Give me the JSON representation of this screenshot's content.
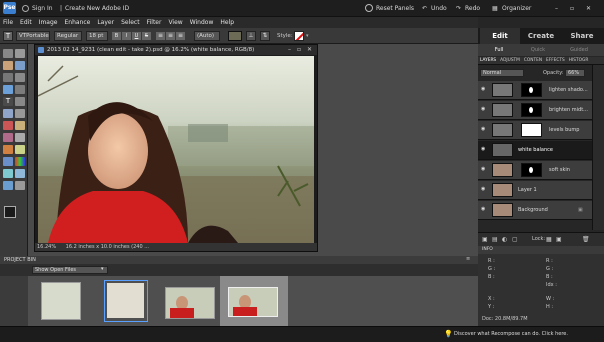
{
  "topbar": {
    "logo_text": "Pse",
    "sign_in": "Sign In",
    "create_id": "Create New Adobe ID",
    "reset_panels": "Reset Panels",
    "undo": "Undo",
    "redo": "Redo",
    "organizer": "Organizer"
  },
  "menu": [
    "File",
    "Edit",
    "Image",
    "Enhance",
    "Layer",
    "Select",
    "Filter",
    "View",
    "Window",
    "Help"
  ],
  "options": {
    "font": "VTPortable...",
    "style": "Regular",
    "size": "18 pt",
    "leading": "(Auto)",
    "style_label": "Style:"
  },
  "document": {
    "title": "2013 02 14_9231 (clean edit - take 2).psd @ 16.2% (white balance, RGB/8)",
    "zoom": "16.24%",
    "dimensions": "16.2 inches x 10.0 inches (240 ..."
  },
  "bin": {
    "title": "PROJECT BIN",
    "dropdown": "Show Open Files"
  },
  "mode_tabs": [
    "Edit",
    "Create",
    "Share"
  ],
  "sub_tabs": [
    "Full",
    "Quick",
    "Guided"
  ],
  "panel_tabs": [
    "LAYERS",
    "ADJUSTM",
    "CONTEN",
    "EFFECTS",
    "HISTOGR"
  ],
  "layers": {
    "blend_mode": "Normal",
    "opacity_label": "Opacity:",
    "opacity": "66%",
    "lock_label": "Lock:",
    "items": [
      {
        "name": "lighten shado..."
      },
      {
        "name": "brighten midt..."
      },
      {
        "name": "levels bump"
      },
      {
        "name": "white balance"
      },
      {
        "name": "soft skin"
      },
      {
        "name": "Layer 1"
      },
      {
        "name": "Background"
      }
    ]
  },
  "info": {
    "title": "INFO",
    "r": "R :",
    "g": "G :",
    "b": "B :",
    "r2": "R :",
    "g2": "G :",
    "b2": "B :",
    "idx": "Idx :",
    "x": "X :",
    "y": "Y :",
    "w": "W :",
    "h": "H :",
    "doc": "Doc: 20.8M/89.7M"
  },
  "footer": {
    "tip": "Discover what Recompose can do. Click here."
  },
  "colors": {
    "accent_blue": "#3a7fd0",
    "selected_layer": "#1a1a1a"
  }
}
